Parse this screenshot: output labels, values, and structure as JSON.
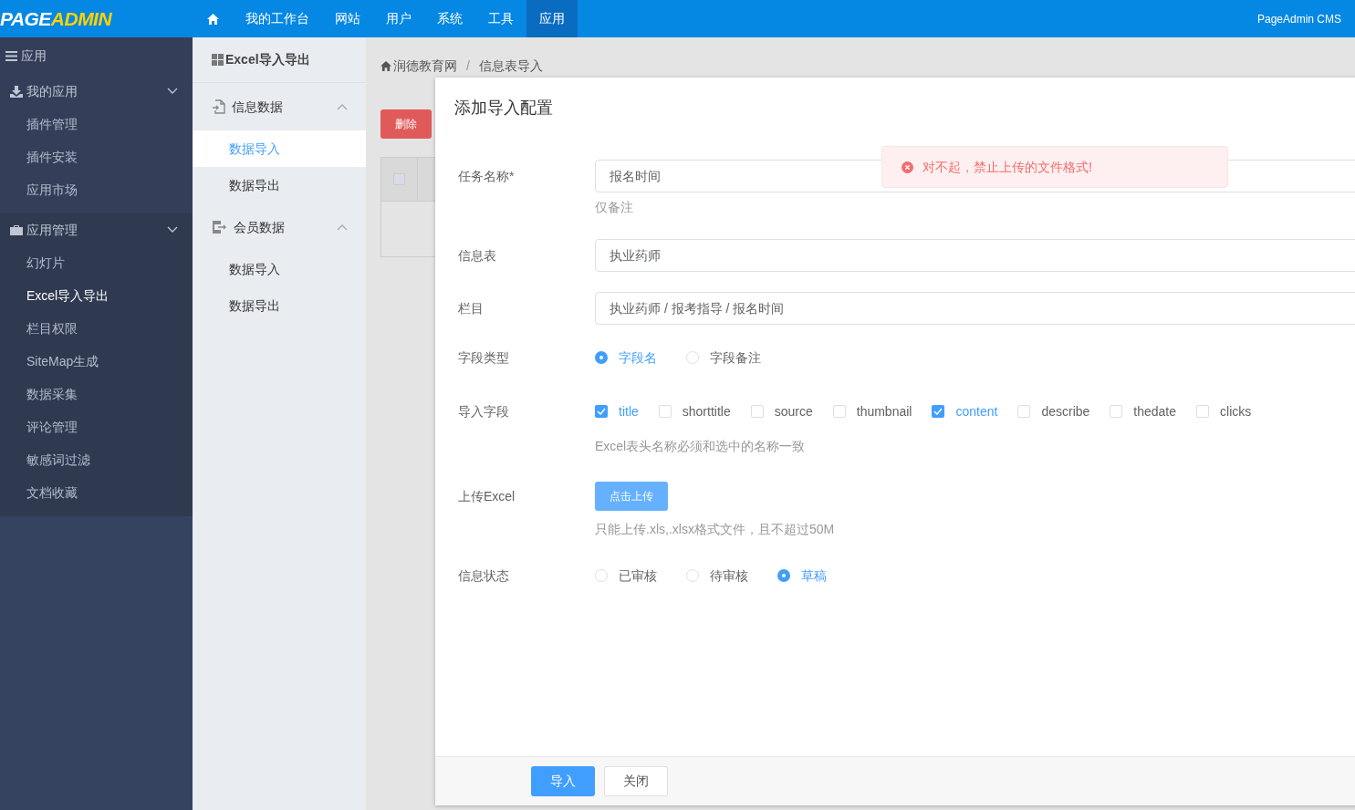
{
  "topbar": {
    "logo": {
      "part1": "PAGE",
      "part2": "ADMIN"
    },
    "nav": [
      {
        "label": "我的工作台",
        "selected": false
      },
      {
        "label": "网站",
        "selected": false
      },
      {
        "label": "用户",
        "selected": false
      },
      {
        "label": "系统",
        "selected": false
      },
      {
        "label": "工具",
        "selected": false
      },
      {
        "label": "应用",
        "selected": true
      }
    ],
    "brand": "PageAdmin CMS"
  },
  "sidebar": {
    "title": "应用",
    "groups": [
      {
        "label": "我的应用",
        "items": [
          {
            "label": "插件管理",
            "selected": false
          },
          {
            "label": "插件安装",
            "selected": false
          },
          {
            "label": "应用市场",
            "selected": false
          }
        ]
      },
      {
        "label": "应用管理",
        "items": [
          {
            "label": "幻灯片",
            "selected": false
          },
          {
            "label": "Excel导入导出",
            "selected": true
          },
          {
            "label": "栏目权限",
            "selected": false
          },
          {
            "label": "SiteMap生成",
            "selected": false
          },
          {
            "label": "数据采集",
            "selected": false
          },
          {
            "label": "评论管理",
            "selected": false
          },
          {
            "label": "敏感词过滤",
            "selected": false
          },
          {
            "label": "文档收藏",
            "selected": false
          }
        ]
      }
    ]
  },
  "subnav": {
    "title": "Excel导入导出",
    "groups": [
      {
        "label": "信息数据",
        "items": [
          {
            "label": "数据导入",
            "selected": true
          },
          {
            "label": "数据导出",
            "selected": false
          }
        ]
      },
      {
        "label": "会员数据",
        "items": [
          {
            "label": "数据导入",
            "selected": false
          },
          {
            "label": "数据导出",
            "selected": false
          }
        ]
      }
    ]
  },
  "breadcrumb": {
    "items": [
      "润德教育网",
      "信息表导入"
    ],
    "separator": "/"
  },
  "delete_button": "删除",
  "table": {
    "header_checked": false
  },
  "dialog": {
    "title": "添加导入配置",
    "rows": [
      {
        "kind": "text",
        "label": "任务名称*",
        "value": "报名时间",
        "help": "仅备注"
      },
      {
        "kind": "text",
        "label": "信息表",
        "value": "执业药师"
      },
      {
        "kind": "text",
        "label": "栏目",
        "value": "执业药师 / 报考指导 / 报名时间"
      },
      {
        "kind": "radio",
        "label": "字段类型",
        "options": [
          {
            "label": "字段名",
            "selected": true
          },
          {
            "label": "字段备注",
            "selected": false
          }
        ]
      },
      {
        "kind": "checkbox",
        "label": "导入字段",
        "options": [
          {
            "label": "title",
            "checked": true
          },
          {
            "label": "shorttitle",
            "checked": false
          },
          {
            "label": "source",
            "checked": false
          },
          {
            "label": "thumbnail",
            "checked": false
          },
          {
            "label": "content",
            "checked": true
          },
          {
            "label": "describe",
            "checked": false
          },
          {
            "label": "thedate",
            "checked": false
          },
          {
            "label": "clicks",
            "checked": false
          }
        ],
        "help": "Excel表头名称必须和选中的名称一致"
      },
      {
        "kind": "upload",
        "label": "上传Excel",
        "button": "点击上传",
        "help": "只能上传.xls,.xlsx格式文件，且不超过50M"
      },
      {
        "kind": "radio",
        "label": "信息状态",
        "options": [
          {
            "label": "已审核",
            "selected": false
          },
          {
            "label": "待审核",
            "selected": false
          },
          {
            "label": "草稿",
            "selected": true
          }
        ]
      }
    ],
    "buttons": {
      "primary": "导入",
      "secondary": "关闭"
    }
  },
  "toast": {
    "message": "对不起，禁止上传的文件格式!"
  }
}
